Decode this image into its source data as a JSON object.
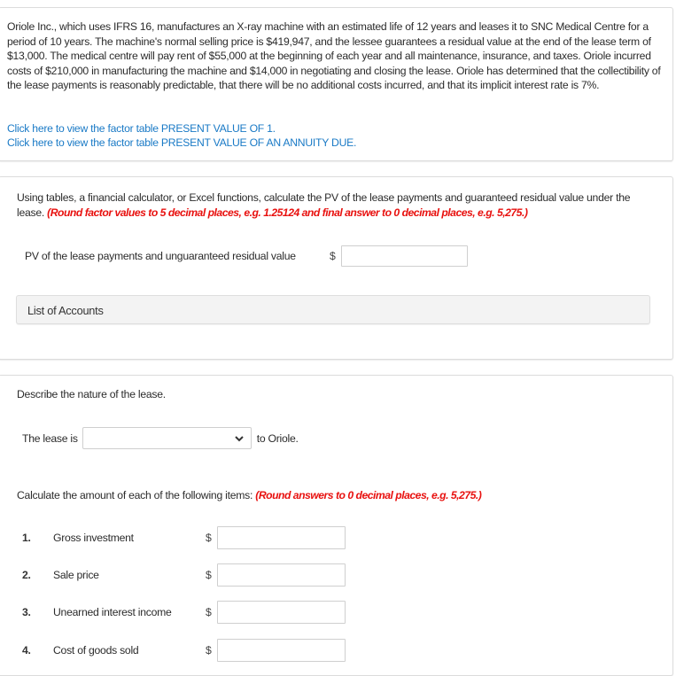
{
  "problem": {
    "text": "Oriole Inc., which uses IFRS 16, manufactures an X-ray machine with an estimated life of 12 years and leases it to SNC Medical Centre for a period of 10 years. The machine's normal selling price is $419,947, and the lessee guarantees a residual value at the end of the lease term of $13,000. The medical centre will pay rent of $55,000 at the beginning of each year and all maintenance, insurance, and taxes. Oriole incurred costs of $210,000 in manufacturing the machine and $14,000 in negotiating and closing the lease. Oriole has determined that the collectibility of the lease payments is reasonably predictable, that there will be no additional costs incurred, and that its implicit interest rate is 7%.",
    "links": [
      "Click here to view the factor table PRESENT VALUE OF 1.",
      "Click here to view the factor table PRESENT VALUE OF AN ANNUITY DUE."
    ]
  },
  "part_pv": {
    "instruction": "Using tables, a financial calculator, or Excel functions, calculate the PV of the lease payments and guaranteed residual value under the lease. ",
    "rounding_note": "(Round factor values to 5 decimal places, e.g. 1.25124 and final answer to 0 decimal places, e.g. 5,275.)",
    "field_label": "PV of the lease payments and unguaranteed residual value",
    "currency": "$",
    "value": "",
    "accounts_label": "List of Accounts"
  },
  "part_nature": {
    "instruction": "Describe the nature of the lease.",
    "prefix": "The lease is",
    "selected": "",
    "suffix": "to Oriole.",
    "calc_instruction": "Calculate the amount of each of the following items: ",
    "calc_note": "(Round answers to 0 decimal places, e.g. 5,275.)",
    "items": [
      {
        "num": "1.",
        "label": "Gross investment",
        "currency": "$",
        "value": ""
      },
      {
        "num": "2.",
        "label": "Sale price",
        "currency": "$",
        "value": ""
      },
      {
        "num": "3.",
        "label": "Unearned interest income",
        "currency": "$",
        "value": ""
      },
      {
        "num": "4.",
        "label": "Cost of goods sold",
        "currency": "$",
        "value": ""
      }
    ]
  },
  "colors": {
    "link": "#1a7ac6",
    "note_red": "#e8110f",
    "accounts_bg": "#f3f3f3"
  }
}
